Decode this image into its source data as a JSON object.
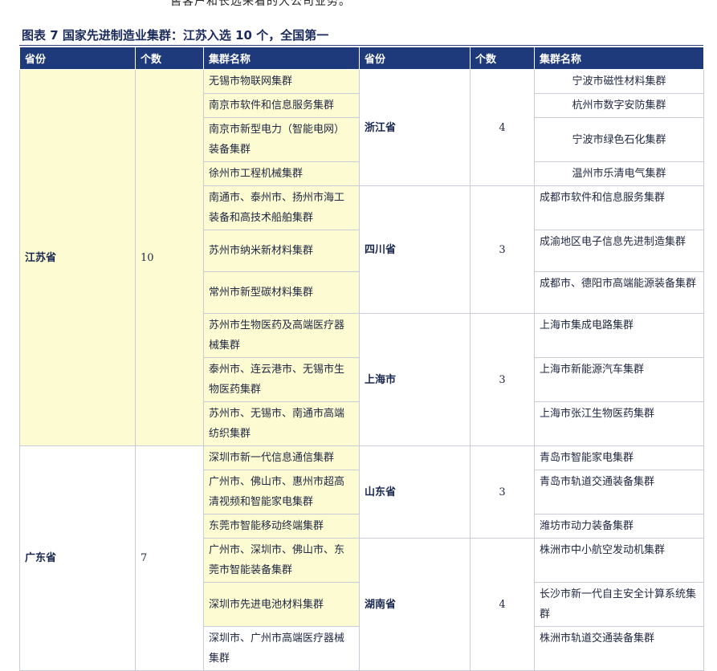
{
  "top_text": "售客户和长远来看的大公司业务。",
  "caption": "图表 7   国家先进制造业集群：江苏入选 10 个，全国第一",
  "headers": [
    "省份",
    "个数",
    "集群名称",
    "省份",
    "个数",
    "集群名称"
  ],
  "left": {
    "jiangsu": {
      "province": "江苏省",
      "count": "10",
      "clusters": [
        "无锡市物联网集群",
        "南京市软件和信息服务集群",
        "南京市新型电力（智能电网）装备集群",
        "徐州市工程机械集群",
        "南通市、泰州市、扬州市海工装备和高技术船舶集群",
        "苏州市纳米新材料集群",
        "常州市新型碳材料集群",
        "苏州市生物医药及高端医疗器械集群",
        "泰州市、连云港市、无锡市生物医药集群",
        "苏州市、无锡市、南通市高端纺织集群"
      ]
    },
    "guangdong": {
      "province": "广东省",
      "count": "7",
      "clusters": [
        "深圳市新一代信息通信集群",
        "广州市、佛山市、惠州市超高清视频和智能家电集群",
        "东莞市智能移动终端集群",
        "广州市、深圳市、佛山市、东莞市智能装备集群",
        "深圳市先进电池材料集群",
        "深圳市、广州市高端医疗器械集群"
      ]
    }
  },
  "right": {
    "zhejiang": {
      "province": "浙江省",
      "count": "4",
      "clusters": [
        "宁波市磁性材料集群",
        "杭州市数字安防集群",
        "宁波市绿色石化集群",
        "温州市乐清电气集群"
      ]
    },
    "sichuan": {
      "province": "四川省",
      "count": "3",
      "clusters": [
        "成都市软件和信息服务集群",
        "成渝地区电子信息先进制造集群",
        "成都市、德阳市高端能源装备集群"
      ]
    },
    "shanghai": {
      "province": "上海市",
      "count": "3",
      "clusters": [
        "上海市集成电路集群",
        "上海市新能源汽车集群",
        "上海市张江生物医药集群"
      ]
    },
    "shandong": {
      "province": "山东省",
      "count": "3",
      "clusters": [
        "青岛市智能家电集群",
        "青岛市轨道交通装备集群",
        "潍坊市动力装备集群"
      ]
    },
    "hunan": {
      "province": "湖南省",
      "count": "4",
      "clusters": [
        "株洲市中小航空发动机集群",
        "长沙市新一代自主安全计算系统集群",
        "株洲市轨道交通装备集群"
      ]
    }
  }
}
